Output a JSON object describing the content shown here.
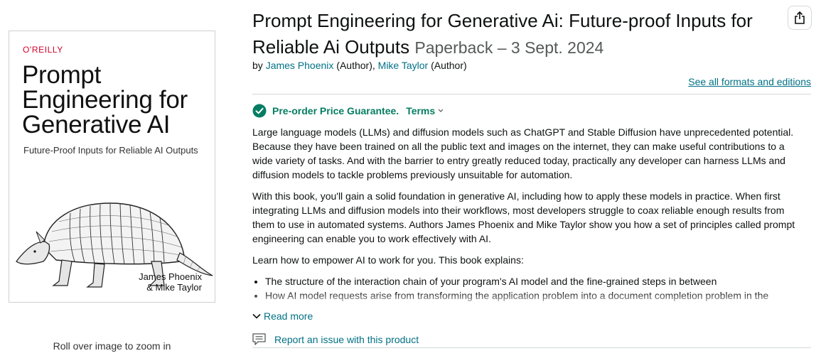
{
  "cover": {
    "publisher": "O'REILLY",
    "title_lines": [
      "Prompt",
      "Engineering for",
      "Generative AI"
    ],
    "subtitle": "Future-Proof Inputs for Reliable AI Outputs",
    "authors_lines": [
      "James Phoenix",
      "& Mike Taylor"
    ]
  },
  "zoom_hint": "Roll over image to zoom in",
  "product": {
    "title": "Prompt Engineering for Generative Ai: Future-proof Inputs for Reliable Ai Outputs",
    "format": "Paperback – 3 Sept. 2024",
    "by_label": "by",
    "authors": [
      {
        "name": "James Phoenix",
        "role": "(Author),"
      },
      {
        "name": "Mike Taylor",
        "role": "(Author)"
      }
    ],
    "see_all_formats": "See all formats and editions"
  },
  "share_icon": "share-icon",
  "guarantee": {
    "label": "Pre-order Price Guarantee.",
    "terms": "Terms",
    "icon": "check-circle-icon",
    "color": "#067d62"
  },
  "description": {
    "paragraphs": [
      "Large language models (LLMs) and diffusion models such as ChatGPT and Stable Diffusion have unprecedented potential. Because they have been trained on all the public text and images on the internet, they can make useful contributions to a wide variety of tasks. And with the barrier to entry greatly reduced today, practically any developer can harness LLMs and diffusion models to tackle problems previously unsuitable for automation.",
      "With this book, you'll gain a solid foundation in generative AI, including how to apply these models in practice. When first integrating LLMs and diffusion models into their workflows, most developers struggle to coax reliable enough results from them to use in automated systems. Authors James Phoenix and Mike Taylor show you how a set of principles called prompt engineering can enable you to work effectively with AI.",
      "Learn how to empower AI to work for you. This book explains:"
    ],
    "bullets": [
      "The structure of the interaction chain of your program's AI model and the fine-grained steps in between",
      "How AI model requests arise from transforming the application problem into a document completion problem in the"
    ],
    "read_more": "Read more"
  },
  "report_issue": "Report an issue with this product",
  "colors": {
    "link": "#007185",
    "text": "#0f1111",
    "muted": "#565959",
    "divider": "#d5d9d9"
  }
}
